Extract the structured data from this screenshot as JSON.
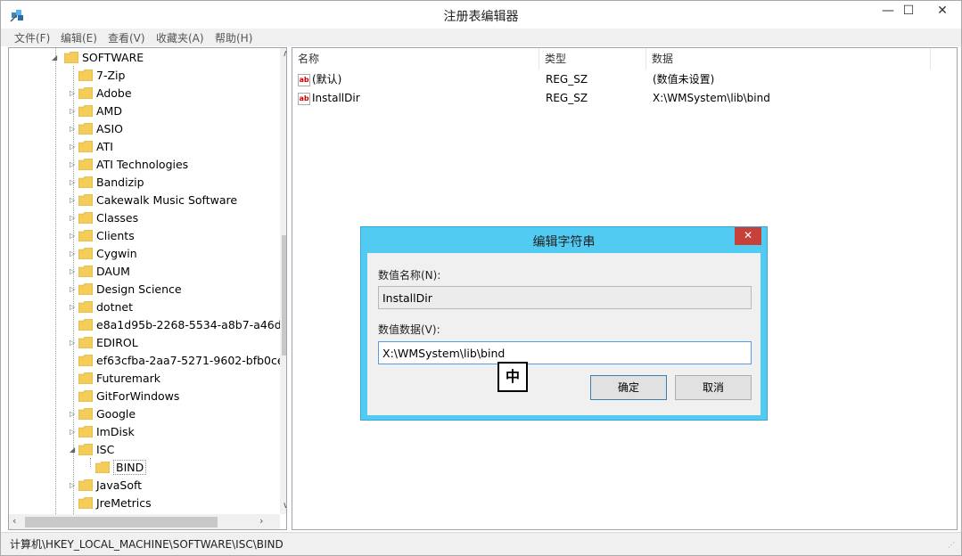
{
  "window": {
    "title": "注册表编辑器",
    "minimize": "—",
    "maximize": "☐",
    "close": "✕"
  },
  "menu": [
    "文件(F)",
    "编辑(E)",
    "查看(V)",
    "收藏夹(A)",
    "帮助(H)"
  ],
  "tree": {
    "root": "SOFTWARE",
    "items": [
      "7-Zip",
      "Adobe",
      "AMD",
      "ASIO",
      "ATI",
      "ATI Technologies",
      "Bandizip",
      "Cakewalk Music Software",
      "Classes",
      "Clients",
      "Cygwin",
      "DAUM",
      "Design Science",
      "dotnet",
      "e8a1d95b-2268-5534-a8b7-a46d",
      "EDIROL",
      "ef63cfba-2aa7-5271-9602-bfb0ce",
      "Futuremark",
      "GitForWindows",
      "Google",
      "ImDisk",
      "ISC",
      "BIND",
      "JavaSoft",
      "JreMetrics"
    ]
  },
  "list": {
    "columns": [
      "名称",
      "类型",
      "数据"
    ],
    "rows": [
      {
        "name": "(默认)",
        "type": "REG_SZ",
        "data": "(数值未设置)"
      },
      {
        "name": "InstallDir",
        "type": "REG_SZ",
        "data": "X:\\WMSystem\\lib\\bind"
      }
    ]
  },
  "status": {
    "path": "计算机\\HKEY_LOCAL_MACHINE\\SOFTWARE\\ISC\\BIND"
  },
  "dialog": {
    "title": "编辑字符串",
    "close": "✕",
    "name_label": "数值名称(N):",
    "name_value": "InstallDir",
    "data_label": "数值数据(V):",
    "data_value": "X:\\WMSystem\\lib\\bind",
    "ok": "确定",
    "cancel": "取消"
  },
  "ime": {
    "indicator": "中"
  },
  "icons": {
    "app": "regedit-icon",
    "folder": "folder-icon",
    "value": "string-value-icon"
  },
  "colors": {
    "dialog_frame": "#52cbf3",
    "close_button": "#c7403a",
    "folder": "#f3cc5a"
  }
}
